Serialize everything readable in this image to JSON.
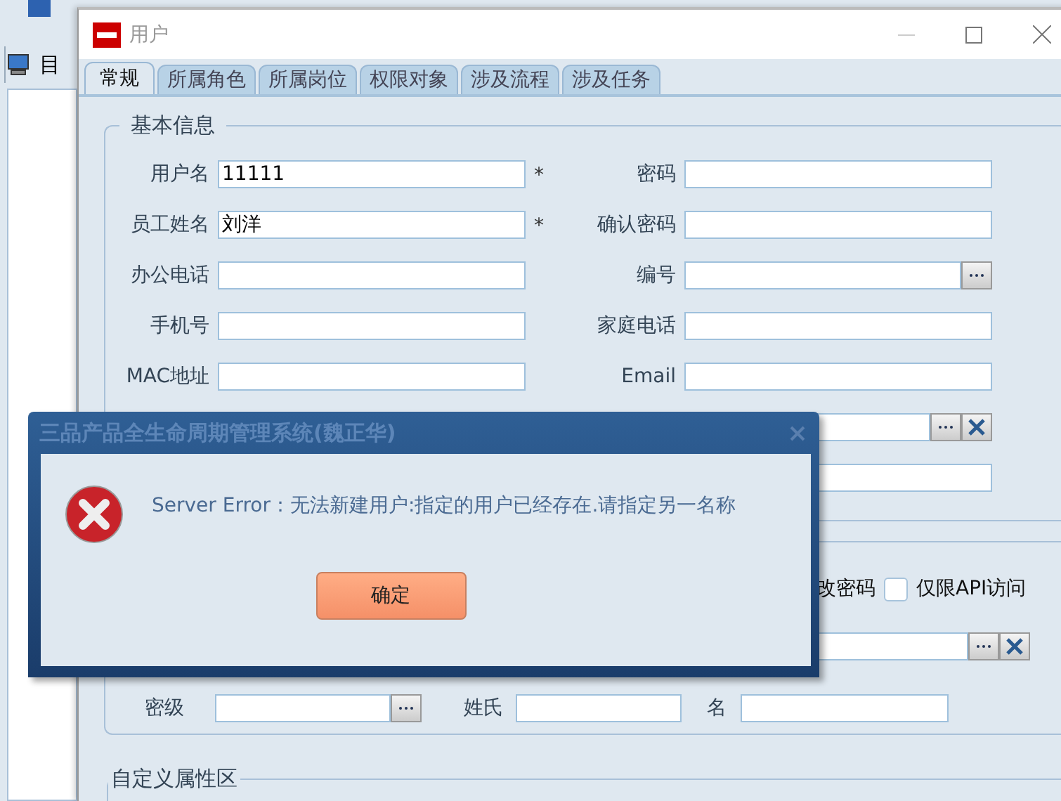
{
  "background_app": {
    "toolbar_label": "目"
  },
  "window": {
    "title": "用户"
  },
  "tabs": [
    {
      "label": "常规",
      "selected": true
    },
    {
      "label": "所属角色",
      "selected": false
    },
    {
      "label": "所属岗位",
      "selected": false
    },
    {
      "label": "权限对象",
      "selected": false
    },
    {
      "label": "涉及流程",
      "selected": false
    },
    {
      "label": "涉及任务",
      "selected": false
    }
  ],
  "basic_info": {
    "legend": "基本信息",
    "rows": [
      {
        "left": {
          "label": "用户名",
          "value": "11111",
          "marker": "*"
        },
        "right": {
          "label": "密码",
          "kind": "text"
        }
      },
      {
        "left": {
          "label": "员工姓名",
          "value": "刘洋",
          "marker": "*"
        },
        "right": {
          "label": "确认密码",
          "kind": "text"
        }
      },
      {
        "left": {
          "label": "办公电话"
        },
        "right": {
          "label": "编号",
          "kind": "browse"
        }
      },
      {
        "left": {
          "label": "手机号"
        },
        "right": {
          "label": "家庭电话",
          "kind": "text"
        }
      },
      {
        "left": {
          "label": "MAC地址"
        },
        "right": {
          "label": "Email",
          "kind": "text"
        }
      },
      {
        "left": null,
        "right": {
          "kind": "browse_clear"
        }
      },
      {
        "left": null,
        "right": {
          "kind": "text"
        }
      }
    ]
  },
  "options": {
    "partial_label": "改密码",
    "checkbox": {
      "label": "仅限API访问",
      "checked": false
    },
    "lookup_field": {
      "kind": "browse_clear"
    },
    "name_row": [
      {
        "label": "密级",
        "kind": "browse"
      },
      {
        "label": "姓氏",
        "kind": "text"
      },
      {
        "label": "名",
        "kind": "text"
      }
    ]
  },
  "custom_section": {
    "legend": "自定义属性区"
  },
  "dialog": {
    "title": "三品产品全生命周期管理系统(魏正华)",
    "message": "Server Error：无法新建用户:指定的用户已经存在.请指定另一名称",
    "button": "确定"
  }
}
